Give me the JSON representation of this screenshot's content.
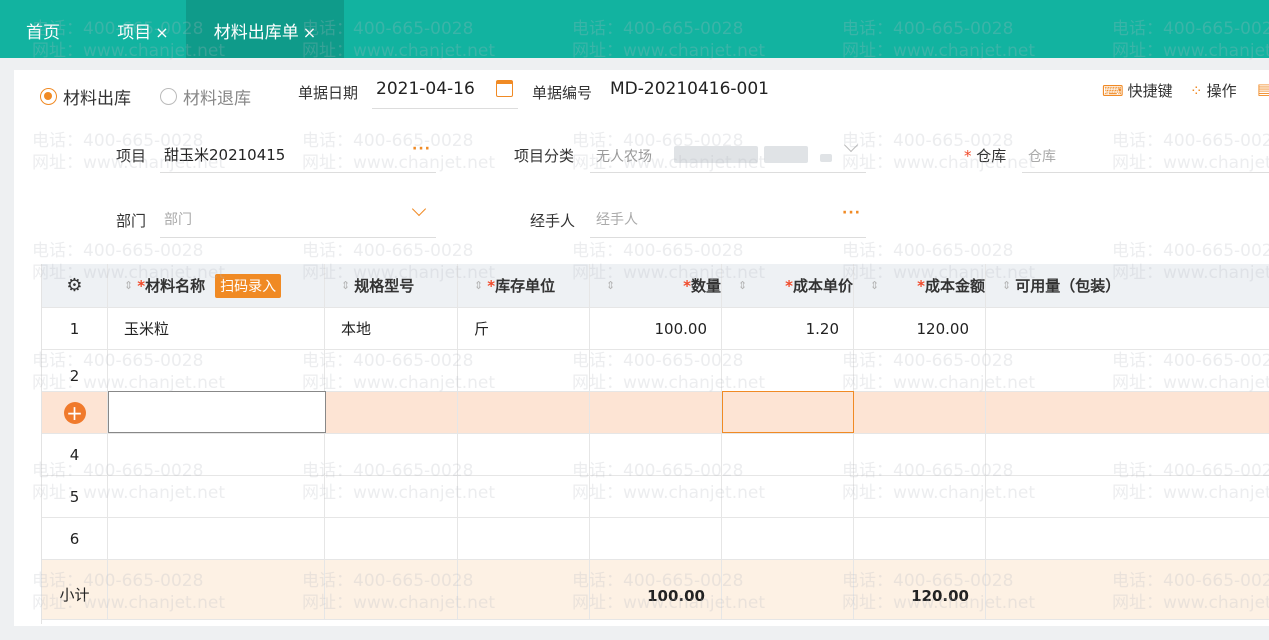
{
  "tabs": [
    {
      "label": "首页",
      "closable": false,
      "active": false
    },
    {
      "label": "项目",
      "closable": true,
      "active": false
    },
    {
      "label": "材料出库单",
      "closable": true,
      "active": true
    }
  ],
  "close_glyph": "×",
  "mode": {
    "options": [
      "材料出库",
      "材料退库"
    ],
    "selected": "材料出库"
  },
  "header": {
    "date_label": "单据日期",
    "date_value": "2021-04-16",
    "doc_no_label": "单据编号",
    "doc_no_value": "MD-20210416-001"
  },
  "toolbar": {
    "shortcut": "快捷键",
    "operate": "操作"
  },
  "form": {
    "project_label": "项目",
    "project_value": "甜玉米20210415",
    "category_label": "项目分类",
    "category_value": "无人农场",
    "warehouse_label": "仓库",
    "warehouse_placeholder": "仓库",
    "dept_label": "部门",
    "dept_placeholder": "部门",
    "handler_label": "经手人",
    "handler_placeholder": "经手人"
  },
  "table": {
    "scan_button": "扫码录入",
    "columns": [
      {
        "label": "材料名称",
        "required": true
      },
      {
        "label": "规格型号",
        "required": false
      },
      {
        "label": "库存单位",
        "required": true
      },
      {
        "label": "数量",
        "required": true
      },
      {
        "label": "成本单价",
        "required": true
      },
      {
        "label": "成本金额",
        "required": true
      },
      {
        "label": "可用量（包装）",
        "required": false
      }
    ],
    "rows": [
      {
        "idx": "1",
        "name": "玉米粒",
        "spec": "本地",
        "unit": "斤",
        "qty": "100.00",
        "price": "1.20",
        "amount": "120.00",
        "avail": ""
      },
      {
        "idx": "2",
        "name": "",
        "spec": "",
        "unit": "",
        "qty": "",
        "price": "",
        "amount": "",
        "avail": ""
      },
      {
        "idx": "",
        "name": "",
        "spec": "",
        "unit": "",
        "qty": "",
        "price": "",
        "amount": "",
        "avail": ""
      },
      {
        "idx": "4",
        "name": "",
        "spec": "",
        "unit": "",
        "qty": "",
        "price": "",
        "amount": "",
        "avail": ""
      },
      {
        "idx": "5",
        "name": "",
        "spec": "",
        "unit": "",
        "qty": "",
        "price": "",
        "amount": "",
        "avail": ""
      },
      {
        "idx": "6",
        "name": "",
        "spec": "",
        "unit": "",
        "qty": "",
        "price": "",
        "amount": "",
        "avail": ""
      }
    ],
    "subtotal": {
      "label": "小计",
      "qty": "100.00",
      "amount": "120.00"
    }
  },
  "watermark": {
    "line1": "电话：400-665-0028",
    "line2": "网址：www.chanjet.net"
  },
  "colors": {
    "accent": "#f08a24",
    "topbar": "#12b3a0",
    "active_tab": "#0f9b8a",
    "required": "#f04a2a"
  },
  "icons": [
    "calendar-icon",
    "keyboard-icon",
    "grid-icon",
    "settings-icon",
    "add-row-icon"
  ]
}
